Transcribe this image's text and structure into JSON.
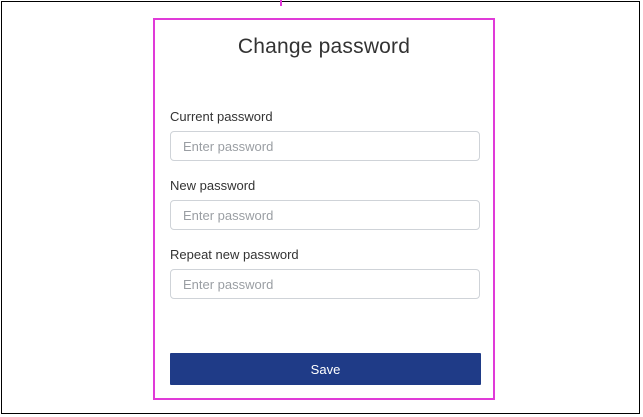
{
  "form": {
    "title": "Change password",
    "fields": [
      {
        "label": "Current password",
        "value": "",
        "placeholder": "Enter password"
      },
      {
        "label": "New password",
        "value": "",
        "placeholder": "Enter password"
      },
      {
        "label": "Repeat new password",
        "value": "",
        "placeholder": "Enter password"
      }
    ],
    "save_label": "Save"
  },
  "colors": {
    "accent_border": "#e03ad8",
    "button_bg": "#1f3b87",
    "button_text": "#ffffff"
  }
}
